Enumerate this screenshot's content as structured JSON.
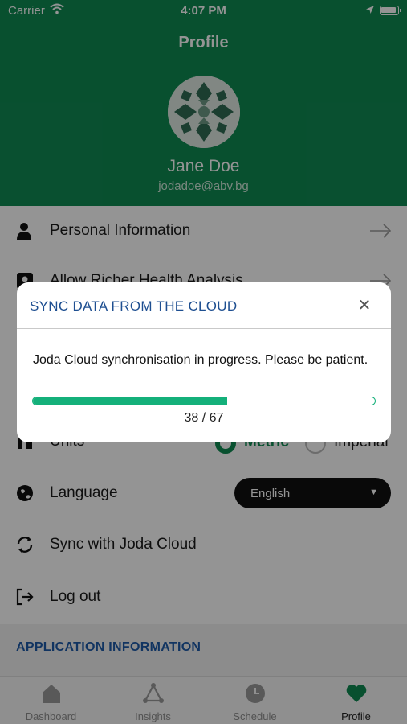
{
  "status_bar": {
    "carrier": "Carrier",
    "time": "4:07 PM"
  },
  "header": {
    "title": "Profile",
    "name": "Jane Doe",
    "email": "jodadoe@abv.bg"
  },
  "menu": {
    "personal_info": "Personal Information",
    "health_analysis": "Allow Richer Health Analysis",
    "units": "Units",
    "units_options": {
      "selected": "Metric",
      "other": "Imperial"
    },
    "language": "Language",
    "language_value": "English",
    "sync": "Sync with Joda Cloud",
    "logout": "Log out"
  },
  "section": {
    "app_info_title": "APPLICATION INFORMATION"
  },
  "tabs": [
    {
      "label": "Dashboard",
      "icon": "home-icon"
    },
    {
      "label": "Insights",
      "icon": "insights-icon"
    },
    {
      "label": "Schedule",
      "icon": "clock-icon"
    },
    {
      "label": "Profile",
      "icon": "heart-icon"
    }
  ],
  "modal": {
    "title": "SYNC DATA FROM THE CLOUD",
    "message": "Joda Cloud synchronisation in progress. Please be patient.",
    "progress_current": 38,
    "progress_total": 67,
    "progress_text": "38 / 67"
  },
  "colors": {
    "brand_green": "#0f8a52",
    "progress_green": "#14b07a",
    "title_blue": "#1e4f91"
  }
}
